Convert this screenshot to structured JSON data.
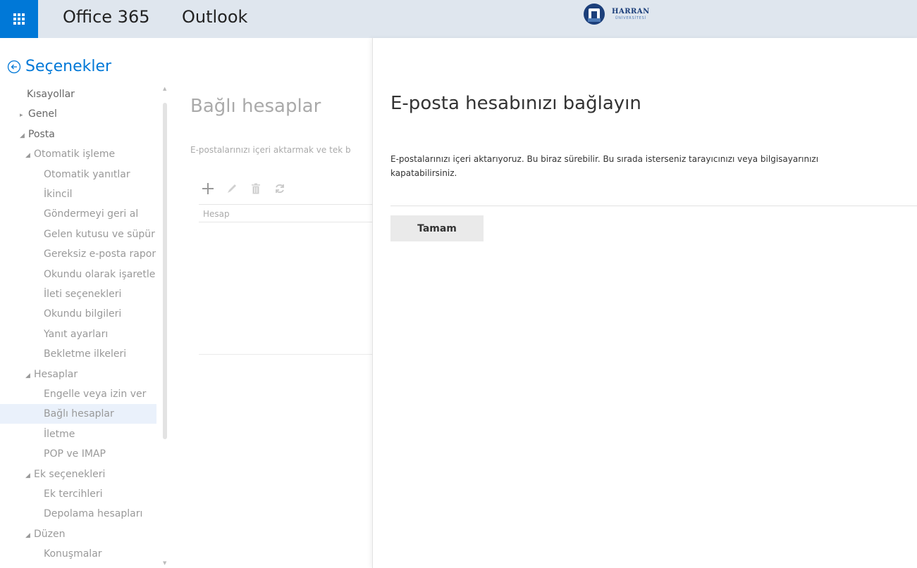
{
  "header": {
    "brand": "Office 365",
    "app": "Outlook",
    "logo_name": "HARRAN",
    "logo_sub": "ÜNİVERSİTESİ",
    "accent_color": "#0078d7",
    "bar_color": "#dfe6ee"
  },
  "options": {
    "title": "Seçenekler",
    "back_icon": "circle-arrow-left-icon"
  },
  "nav": {
    "items": [
      {
        "label": "Kısayollar",
        "level": 0,
        "arrow": ""
      },
      {
        "label": "Genel",
        "level": 0,
        "arrow": "▸"
      },
      {
        "label": "Posta",
        "level": 0,
        "arrow": "◢"
      },
      {
        "label": "Otomatik işleme",
        "level": 1,
        "arrow": "◢"
      },
      {
        "label": "Otomatik yanıtlar",
        "level": 2,
        "arrow": ""
      },
      {
        "label": "İkincil",
        "level": 2,
        "arrow": ""
      },
      {
        "label": "Göndermeyi geri al",
        "level": 2,
        "arrow": ""
      },
      {
        "label": "Gelen kutusu ve süpür",
        "level": 2,
        "arrow": ""
      },
      {
        "label": "Gereksiz e-posta rapor",
        "level": 2,
        "arrow": ""
      },
      {
        "label": "Okundu olarak işaretle",
        "level": 2,
        "arrow": ""
      },
      {
        "label": "İleti seçenekleri",
        "level": 2,
        "arrow": ""
      },
      {
        "label": "Okundu bilgileri",
        "level": 2,
        "arrow": ""
      },
      {
        "label": "Yanıt ayarları",
        "level": 2,
        "arrow": ""
      },
      {
        "label": "Bekletme ilkeleri",
        "level": 2,
        "arrow": ""
      },
      {
        "label": "Hesaplar",
        "level": 1,
        "arrow": "◢"
      },
      {
        "label": "Engelle veya izin ver",
        "level": 2,
        "arrow": ""
      },
      {
        "label": "Bağlı hesaplar",
        "level": 2,
        "arrow": "",
        "selected": true
      },
      {
        "label": "İletme",
        "level": 2,
        "arrow": ""
      },
      {
        "label": "POP ve IMAP",
        "level": 2,
        "arrow": ""
      },
      {
        "label": "Ek seçenekleri",
        "level": 1,
        "arrow": "◢"
      },
      {
        "label": "Ek tercihleri",
        "level": 2,
        "arrow": ""
      },
      {
        "label": "Depolama hesapları",
        "level": 2,
        "arrow": ""
      },
      {
        "label": "Düzen",
        "level": 1,
        "arrow": "◢"
      },
      {
        "label": "Konuşmalar",
        "level": 2,
        "arrow": ""
      }
    ]
  },
  "middle": {
    "title": "Bağlı hesaplar",
    "description": "E-postalarınızı içeri aktarmak ve tek b",
    "column_header": "Hesap"
  },
  "dialog": {
    "title": "E-posta hesabınızı bağlayın",
    "message": "E-postalarınızı içeri aktarıyoruz. Bu biraz sürebilir. Bu sırada isterseniz tarayıcınızı veya bilgisayarınızı kapatabilirsiniz.",
    "ok_label": "Tamam"
  }
}
